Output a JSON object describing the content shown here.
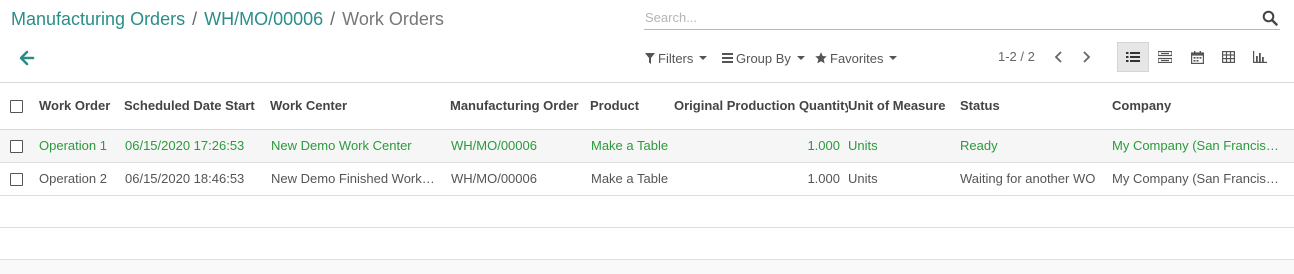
{
  "breadcrumb": {
    "items": [
      {
        "label": "Manufacturing Orders"
      },
      {
        "label": "WH/MO/00006"
      }
    ],
    "separator": "/",
    "current": "Work Orders"
  },
  "search": {
    "placeholder": "Search..."
  },
  "toolbar": {
    "filters_label": "Filters",
    "group_by_label": "Group By",
    "favorites_label": "Favorites"
  },
  "pager": {
    "value": "1-2 / 2"
  },
  "views": [
    "list-view-icon",
    "kanban-view-icon",
    "calendar-view-icon",
    "pivot-view-icon",
    "graph-view-icon"
  ],
  "colors": {
    "accent": "#2b8d8a",
    "ready_green": "#2b9a3b"
  },
  "table": {
    "columns": [
      "Work Order",
      "Scheduled Date Start",
      "Work Center",
      "Manufacturing Order",
      "Product",
      "Original Production Quantity",
      "Unit of Measure",
      "Status",
      "Company"
    ],
    "rows": [
      {
        "work_order": "Operation 1",
        "scheduled_date_start": "06/15/2020 17:26:53",
        "work_center": "New Demo Work Center",
        "manufacturing_order": "WH/MO/00006",
        "product": "Make a Table",
        "quantity": "1.000",
        "uom": "Units",
        "status": "Ready",
        "company": "My Company (San Francisco)"
      },
      {
        "work_order": "Operation 2",
        "scheduled_date_start": "06/15/2020 18:46:53",
        "work_center": "New Demo Finished Work Center",
        "manufacturing_order": "WH/MO/00006",
        "product": "Make a Table",
        "quantity": "1.000",
        "uom": "Units",
        "status": "Waiting for another WO",
        "company": "My Company (San Francisco)"
      }
    ]
  }
}
